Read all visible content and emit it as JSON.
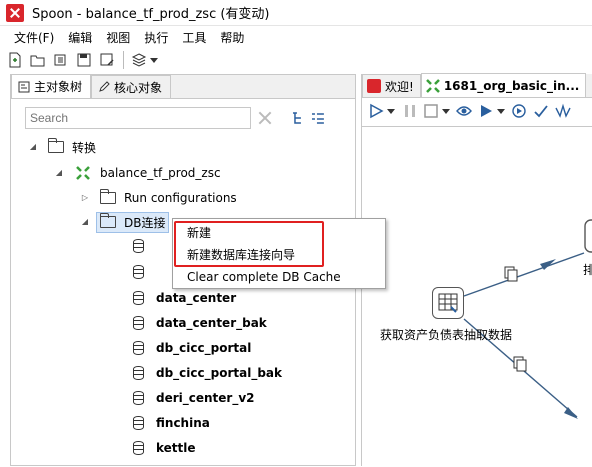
{
  "window": {
    "title": "Spoon - balance_tf_prod_zsc (有变动)"
  },
  "menu": [
    "文件(F)",
    "编辑",
    "视图",
    "执行",
    "工具",
    "帮助"
  ],
  "left_tabs": [
    {
      "label": "主对象树",
      "icon": "tree-icon",
      "active": true
    },
    {
      "label": "核心对象",
      "icon": "pencil-icon",
      "active": false
    }
  ],
  "search": {
    "placeholder": "Search"
  },
  "tree": {
    "root": "转换",
    "transformation": "balance_tf_prod_zsc",
    "run_configurations": "Run configurations",
    "db_connections": "DB连接",
    "connections": [
      "",
      "",
      "data_center",
      "data_center_bak",
      "db_cicc_portal",
      "db_cicc_portal_bak",
      "deri_center_v2",
      "finchina",
      "kettle"
    ]
  },
  "context_menu": {
    "items": [
      "新建",
      "新建数据库连接向导",
      "Clear complete DB Cache"
    ]
  },
  "right_tabs": [
    {
      "label": "欢迎!",
      "icon": "spoon-icon"
    },
    {
      "label": "1681_org_basic_in...",
      "icon": "transformation-icon"
    }
  ],
  "canvas": {
    "step_label": "获取资产负债表抽取数据",
    "partial_label": "排"
  },
  "colors": {
    "accent": "#3aa03a",
    "highlight_border": "#e02020",
    "brand_red": "#d9262c",
    "hop_line": "#3b5f86"
  }
}
